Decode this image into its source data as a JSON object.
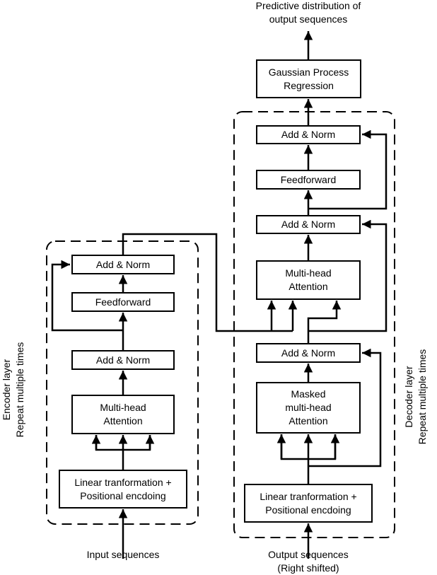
{
  "diagram": {
    "title_top": "Predictive distribution of\noutput sequences",
    "gpr": "Gaussian Process\nRegression",
    "encoder": {
      "side_label": "Encoder layer\nRepeat multiple times",
      "add_norm_top": "Add & Norm",
      "feedforward": "Feedforward",
      "add_norm_bottom": "Add & Norm",
      "attention": "Multi-head\nAttention",
      "embedding": "Linear tranformation +\nPositional encdoing",
      "input_label": "Input sequences"
    },
    "decoder": {
      "side_label": "Decoder layer\nRepeat multiple times",
      "add_norm_top": "Add & Norm",
      "feedforward": "Feedforward",
      "add_norm_mid": "Add & Norm",
      "cross_attention": "Multi-head\nAttention",
      "add_norm_bottom": "Add & Norm",
      "masked_attention": "Masked\nmulti-head\nAttention",
      "embedding": "Linear tranformation +\nPositional encdoing",
      "output_label": "Output sequences\n(Right shifted)"
    }
  }
}
